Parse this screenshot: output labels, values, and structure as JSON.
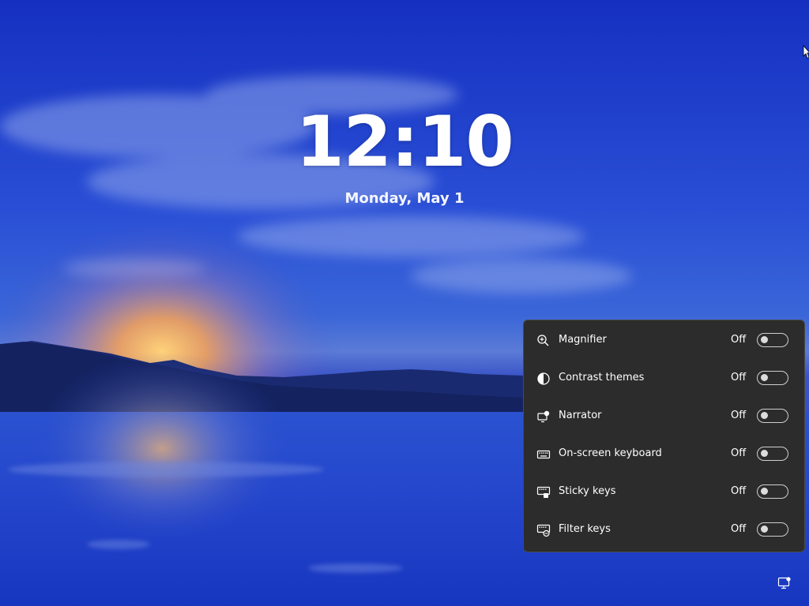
{
  "lock_screen": {
    "time": "12:10",
    "date": "Monday, May 1"
  },
  "accessibility_flyout": {
    "items": [
      {
        "label": "Magnifier",
        "state": "Off",
        "icon": "magnifier-icon"
      },
      {
        "label": "Contrast themes",
        "state": "Off",
        "icon": "contrast-icon"
      },
      {
        "label": "Narrator",
        "state": "Off",
        "icon": "narrator-icon"
      },
      {
        "label": "On-screen keyboard",
        "state": "Off",
        "icon": "keyboard-icon"
      },
      {
        "label": "Sticky keys",
        "state": "Off",
        "icon": "sticky-keys-icon"
      },
      {
        "label": "Filter keys",
        "state": "Off",
        "icon": "filter-keys-icon"
      }
    ]
  },
  "tray": {
    "icon": "accessibility-icon"
  },
  "colors": {
    "sky_top": "#1a32c4",
    "flyout_bg": "#2c2c2c",
    "text": "#ffffff"
  }
}
